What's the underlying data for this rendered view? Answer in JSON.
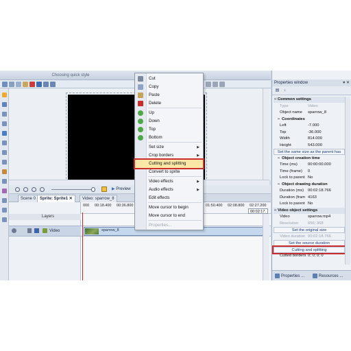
{
  "ribbon": {
    "caption": "Choosing quick style"
  },
  "context_menu": {
    "items": [
      {
        "label": "Cut",
        "icon": "scissors-icon",
        "disabled": false,
        "submenu": false
      },
      {
        "label": "Copy",
        "icon": "copy-icon",
        "disabled": false,
        "submenu": false
      },
      {
        "label": "Paste",
        "icon": "paste-icon",
        "disabled": false,
        "submenu": false
      },
      {
        "label": "Delete",
        "icon": "delete-icon",
        "disabled": false,
        "submenu": false
      },
      {
        "label": "Up",
        "icon": "arrow-up-icon",
        "disabled": false,
        "submenu": false
      },
      {
        "label": "Down",
        "icon": "arrow-down-icon",
        "disabled": false,
        "submenu": false
      },
      {
        "label": "Top",
        "icon": "arrow-top-icon",
        "disabled": false,
        "submenu": false
      },
      {
        "label": "Bottom",
        "icon": "arrow-bottom-icon",
        "disabled": false,
        "submenu": false
      },
      {
        "label": "Set size",
        "icon": "",
        "disabled": false,
        "submenu": true
      },
      {
        "label": "Crop borders",
        "icon": "",
        "disabled": false,
        "submenu": true
      },
      {
        "label": "Cutting and splitting",
        "icon": "",
        "disabled": false,
        "submenu": false,
        "highlighted": true
      },
      {
        "label": "Convert to sprite",
        "icon": "",
        "disabled": false,
        "submenu": false
      },
      {
        "label": "Video effects",
        "icon": "",
        "disabled": false,
        "submenu": true
      },
      {
        "label": "Audio effects",
        "icon": "",
        "disabled": false,
        "submenu": true
      },
      {
        "label": "Edit effects",
        "icon": "",
        "disabled": false,
        "submenu": false
      },
      {
        "label": "Move cursor to begin",
        "icon": "",
        "disabled": false,
        "submenu": false
      },
      {
        "label": "Move cursor to end",
        "icon": "",
        "disabled": false,
        "submenu": false
      },
      {
        "label": "Properties...",
        "icon": "",
        "disabled": true,
        "submenu": false
      }
    ]
  },
  "timeline": {
    "preview_label": "Preview",
    "tabs": [
      "Scene 0",
      "Sprite: Sprite1",
      "Video: sparrow_8"
    ],
    "active_tab": "Sprite: Sprite1",
    "close_glyph": "✕",
    "ruler": [
      "000",
      "00:18.400",
      "00:36.800",
      "01:50.400",
      "02:08.800",
      "02:27.200"
    ],
    "time_display": "00:02:17.",
    "layers_label": "Layers",
    "track_label": "Video",
    "clip_label": "sparrow_8"
  },
  "properties": {
    "title": "Properties window",
    "title_icons": "▾ ✕",
    "rows": [
      {
        "kind": "cat",
        "key": "Common settings",
        "value": ""
      },
      {
        "kind": "dim",
        "key": "Type",
        "value": "Video"
      },
      {
        "kind": "row",
        "key": "Object name",
        "value": "sparrow_8"
      },
      {
        "kind": "sub",
        "key": "Coordinates",
        "value": ""
      },
      {
        "kind": "row",
        "key": "Left",
        "value": "-7.000"
      },
      {
        "kind": "row",
        "key": "Top",
        "value": "-36.000"
      },
      {
        "kind": "row",
        "key": "Width",
        "value": "814.000"
      },
      {
        "kind": "row",
        "key": "Height",
        "value": "543.000"
      },
      {
        "kind": "btn",
        "key": "Set the same size as the parent has",
        "value": ""
      },
      {
        "kind": "sub",
        "key": "Object creation time",
        "value": ""
      },
      {
        "kind": "row",
        "key": "Time (ms)",
        "value": "00:00:00.000"
      },
      {
        "kind": "row",
        "key": "Time (frame)",
        "value": "0"
      },
      {
        "kind": "row",
        "key": "Lock to parent",
        "value": "No"
      },
      {
        "kind": "sub",
        "key": "Object drawing duration",
        "value": ""
      },
      {
        "kind": "row",
        "key": "Duration (ms)",
        "value": "00:02:18.766"
      },
      {
        "kind": "row",
        "key": "Duration (fram",
        "value": "4163"
      },
      {
        "kind": "row",
        "key": "Lock to parent",
        "value": "No"
      },
      {
        "kind": "cat",
        "key": "Video object settings",
        "value": ""
      },
      {
        "kind": "row",
        "key": "Video",
        "value": "sparrow.mp4"
      },
      {
        "kind": "dim",
        "key": "Resolution",
        "value": "656; 368"
      },
      {
        "kind": "btn",
        "key": "Set the original size",
        "value": ""
      },
      {
        "kind": "dim",
        "key": "Video duration",
        "value": "00:02:18.766"
      },
      {
        "kind": "btn",
        "key": "Set the source duration",
        "value": ""
      },
      {
        "kind": "btnbox",
        "key": "Cutting and splitting",
        "value": ""
      },
      {
        "kind": "row",
        "key": "Cutted borders",
        "value": "0; 0; 0; 0"
      }
    ],
    "bottom_tabs": [
      "Properties ...",
      "Resources ..."
    ]
  },
  "colors": {
    "accent_highlight": "#cc2b2b",
    "menu_hover": "#fbe8a6",
    "playhead": "#d02020"
  }
}
